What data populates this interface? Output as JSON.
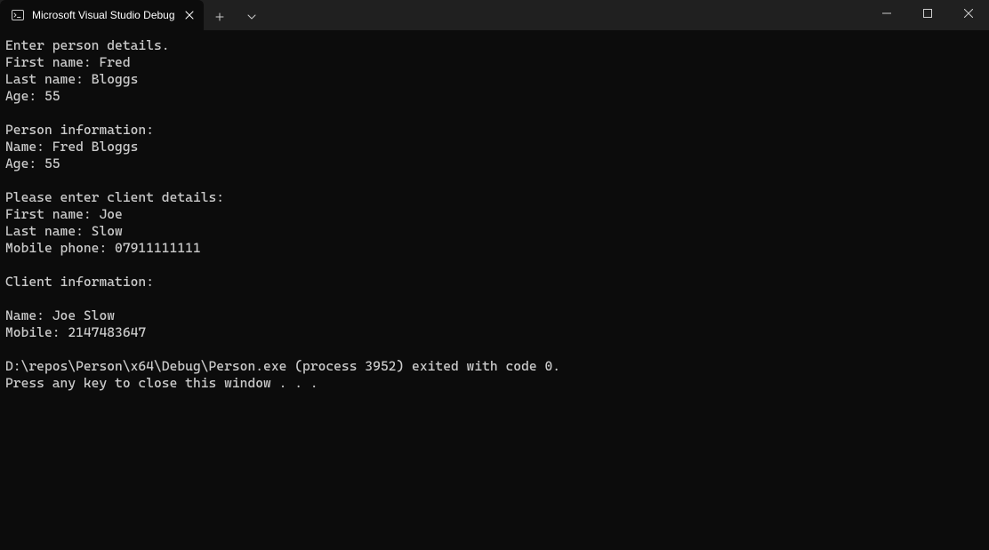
{
  "tab": {
    "title": "Microsoft Visual Studio Debug"
  },
  "console": {
    "text": "Enter person details.\nFirst name: Fred\nLast name: Bloggs\nAge: 55\n\nPerson information:\nName: Fred Bloggs\nAge: 55\n\nPlease enter client details:\nFirst name: Joe\nLast name: Slow\nMobile phone: 07911111111\n\nClient information:\n\nName: Joe Slow\nMobile: 2147483647\n\nD:\\repos\\Person\\x64\\Debug\\Person.exe (process 3952) exited with code 0.\nPress any key to close this window . . ."
  }
}
